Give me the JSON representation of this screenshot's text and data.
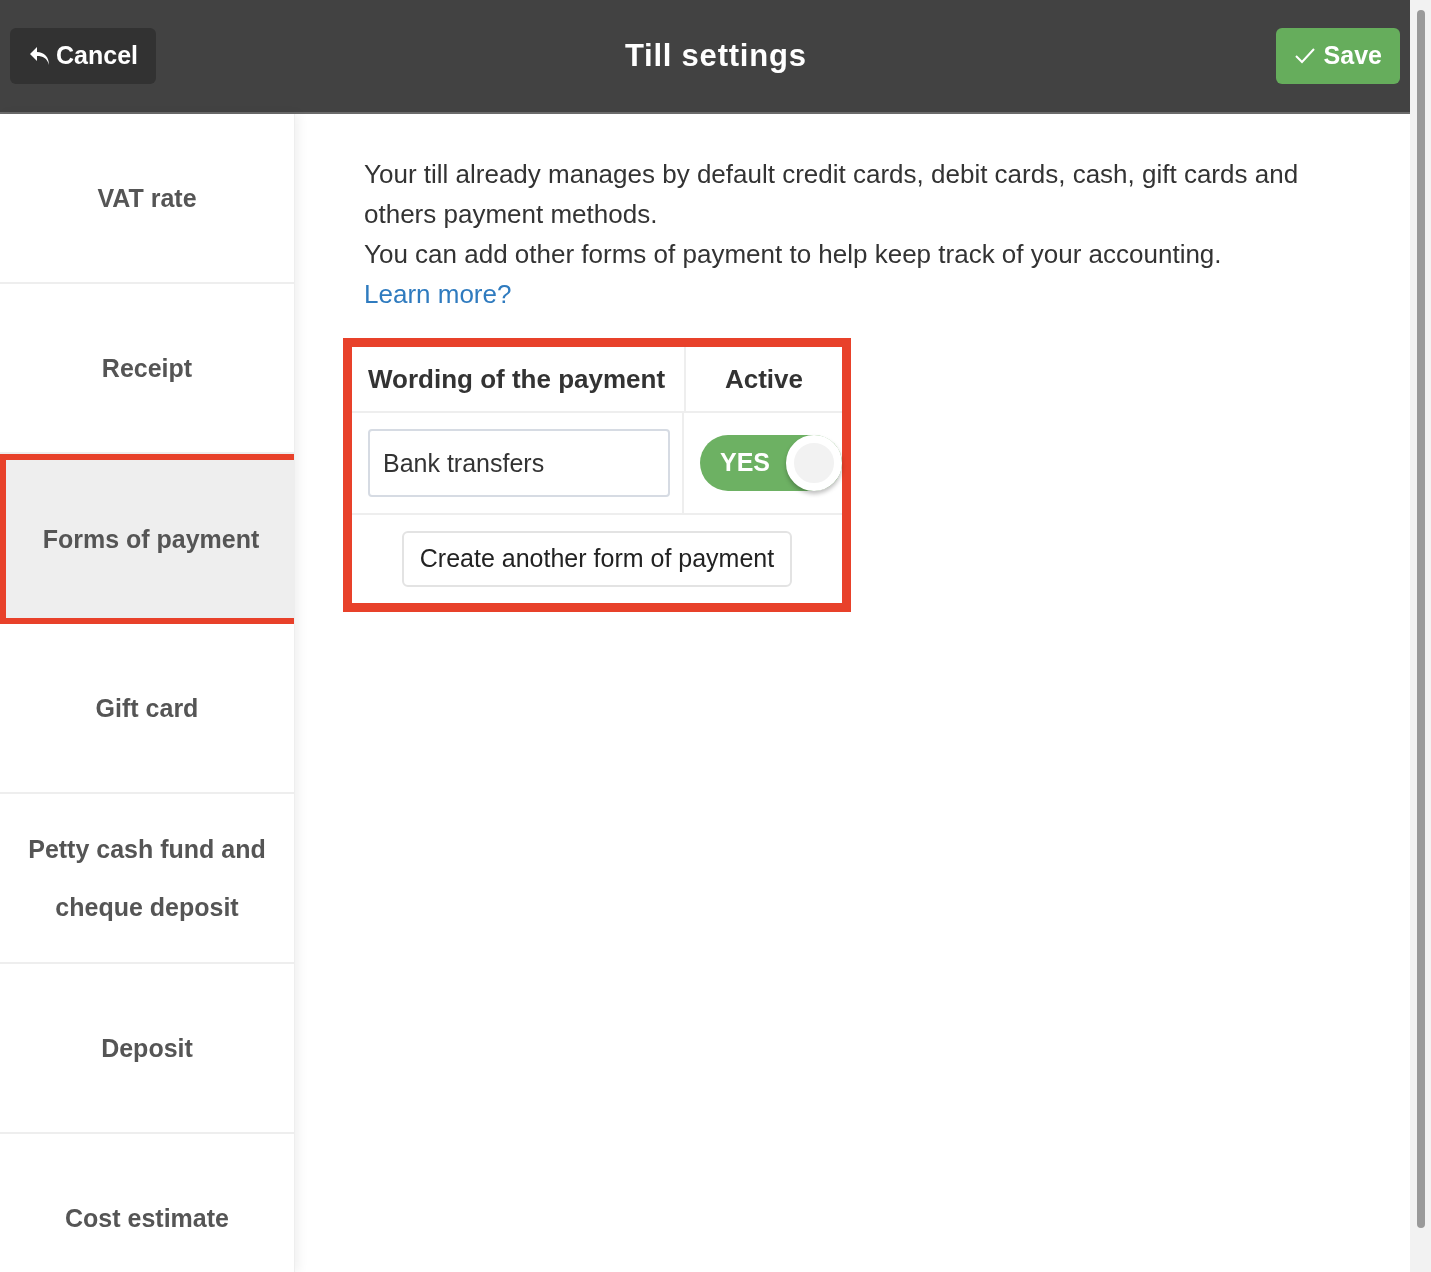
{
  "header": {
    "cancel": "Cancel",
    "title": "Till settings",
    "save": "Save"
  },
  "sidebar": {
    "items": [
      {
        "label": "VAT rate",
        "selected": false,
        "highlighted": false
      },
      {
        "label": "Receipt",
        "selected": false,
        "highlighted": false
      },
      {
        "label": "Forms of payment",
        "selected": true,
        "highlighted": true
      },
      {
        "label": "Gift card",
        "selected": false,
        "highlighted": false
      },
      {
        "label": "Petty cash fund and cheque deposit",
        "selected": false,
        "highlighted": false
      },
      {
        "label": "Deposit",
        "selected": false,
        "highlighted": false
      },
      {
        "label": "Cost estimate",
        "selected": false,
        "highlighted": false
      }
    ]
  },
  "intro": {
    "lines": [
      "Your till already manages by default credit cards, debit cards, cash, gift cards and others payment methods.",
      "You can add other forms of payment to help keep track of your accounting."
    ],
    "link": "Learn more?"
  },
  "table": {
    "highlighted": true,
    "columns": [
      "Wording of the payment",
      "Active"
    ],
    "rows": [
      {
        "wording": "Bank transfers",
        "active": {
          "on": true,
          "label": "YES"
        }
      }
    ],
    "add_button": "Create another form of payment"
  }
}
